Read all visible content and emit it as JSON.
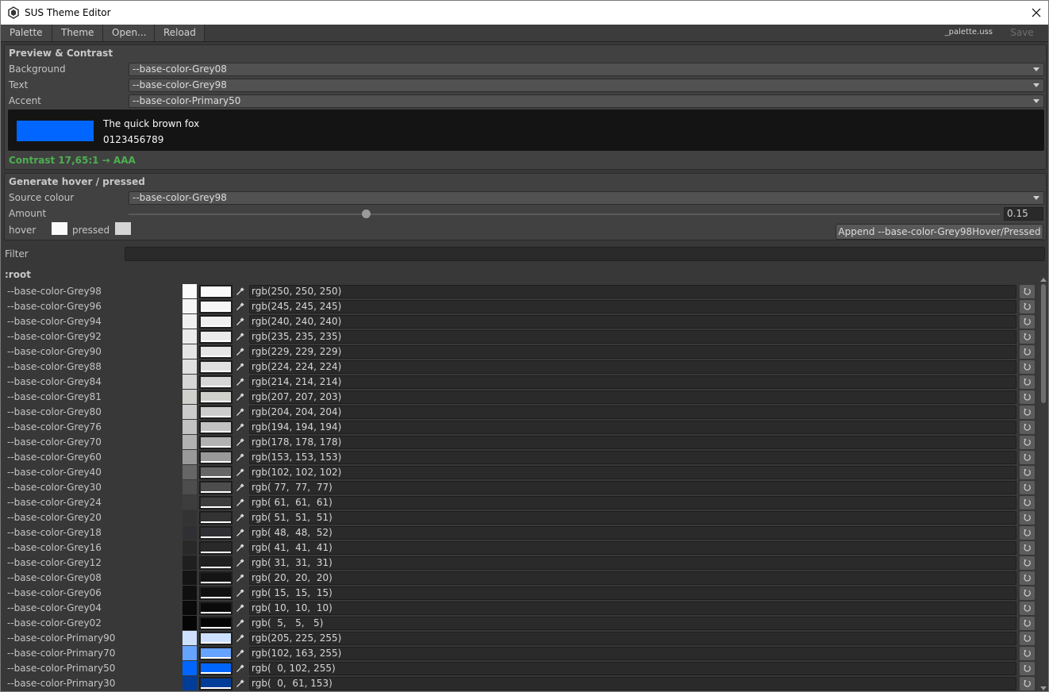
{
  "window": {
    "title": "SUS Theme Editor"
  },
  "menu": {
    "palette": "Palette",
    "theme": "Theme",
    "open": "Open...",
    "reload": "Reload",
    "file": "_palette.uss",
    "save": "Save"
  },
  "preview": {
    "title": "Preview & Contrast",
    "background_label": "Background",
    "background_value": "--base-color-Grey08",
    "text_label": "Text",
    "text_value": "--base-color-Grey98",
    "accent_label": "Accent",
    "accent_value": "--base-color-Primary50",
    "sample_text": "The quick brown fox",
    "sample_digits": "0123456789",
    "contrast": "Contrast 17,65:1  →  AAA",
    "colors": {
      "background": "#141414",
      "text": "#fafafa",
      "accent": "#0066ff",
      "contrast_ok": "#4caf50"
    }
  },
  "generate": {
    "title": "Generate hover / pressed",
    "source_label": "Source colour",
    "source_value": "--base-color-Grey98",
    "amount_label": "Amount",
    "amount_value": "0.15",
    "amount_fraction": 0.15,
    "hover_label": "hover",
    "pressed_label": "pressed",
    "hover_color": "#fafafa",
    "pressed_color": "#d4d4d4",
    "append_button": "Append --base-color-Grey98Hover/Pressed"
  },
  "filter": {
    "label": "Filter",
    "value": ""
  },
  "section": ":root",
  "variables": [
    {
      "name": "--base-color-Grey98",
      "rgb": "rgb(250, 250, 250)",
      "color": "#fafafa"
    },
    {
      "name": "--base-color-Grey96",
      "rgb": "rgb(245, 245, 245)",
      "color": "#f5f5f5"
    },
    {
      "name": "--base-color-Grey94",
      "rgb": "rgb(240, 240, 240)",
      "color": "#f0f0f0"
    },
    {
      "name": "--base-color-Grey92",
      "rgb": "rgb(235, 235, 235)",
      "color": "#ebebeb"
    },
    {
      "name": "--base-color-Grey90",
      "rgb": "rgb(229, 229, 229)",
      "color": "#e5e5e5"
    },
    {
      "name": "--base-color-Grey88",
      "rgb": "rgb(224, 224, 224)",
      "color": "#e0e0e0"
    },
    {
      "name": "--base-color-Grey84",
      "rgb": "rgb(214, 214, 214)",
      "color": "#d6d6d6"
    },
    {
      "name": "--base-color-Grey81",
      "rgb": "rgb(207, 207, 203)",
      "color": "#cfcfcb"
    },
    {
      "name": "--base-color-Grey80",
      "rgb": "rgb(204, 204, 204)",
      "color": "#cccccc"
    },
    {
      "name": "--base-color-Grey76",
      "rgb": "rgb(194, 194, 194)",
      "color": "#c2c2c2"
    },
    {
      "name": "--base-color-Grey70",
      "rgb": "rgb(178, 178, 178)",
      "color": "#b2b2b2"
    },
    {
      "name": "--base-color-Grey60",
      "rgb": "rgb(153, 153, 153)",
      "color": "#999999"
    },
    {
      "name": "--base-color-Grey40",
      "rgb": "rgb(102, 102, 102)",
      "color": "#666666"
    },
    {
      "name": "--base-color-Grey30",
      "rgb": "rgb( 77,  77,  77)",
      "color": "#4d4d4d"
    },
    {
      "name": "--base-color-Grey24",
      "rgb": "rgb( 61,  61,  61)",
      "color": "#3d3d3d"
    },
    {
      "name": "--base-color-Grey20",
      "rgb": "rgb( 51,  51,  51)",
      "color": "#333333"
    },
    {
      "name": "--base-color-Grey18",
      "rgb": "rgb( 48,  48,  52)",
      "color": "#303034"
    },
    {
      "name": "--base-color-Grey16",
      "rgb": "rgb( 41,  41,  41)",
      "color": "#292929"
    },
    {
      "name": "--base-color-Grey12",
      "rgb": "rgb( 31,  31,  31)",
      "color": "#1f1f1f"
    },
    {
      "name": "--base-color-Grey08",
      "rgb": "rgb( 20,  20,  20)",
      "color": "#141414"
    },
    {
      "name": "--base-color-Grey06",
      "rgb": "rgb( 15,  15,  15)",
      "color": "#0f0f0f"
    },
    {
      "name": "--base-color-Grey04",
      "rgb": "rgb( 10,  10,  10)",
      "color": "#0a0a0a"
    },
    {
      "name": "--base-color-Grey02",
      "rgb": "rgb(  5,   5,   5)",
      "color": "#050505"
    },
    {
      "name": "--base-color-Primary90",
      "rgb": "rgb(205, 225, 255)",
      "color": "#cde1ff"
    },
    {
      "name": "--base-color-Primary70",
      "rgb": "rgb(102, 163, 255)",
      "color": "#66a3ff"
    },
    {
      "name": "--base-color-Primary50",
      "rgb": "rgb(  0, 102, 255)",
      "color": "#0066ff"
    },
    {
      "name": "--base-color-Primary30",
      "rgb": "rgb(  0,  61, 153)",
      "color": "#003d99"
    }
  ]
}
